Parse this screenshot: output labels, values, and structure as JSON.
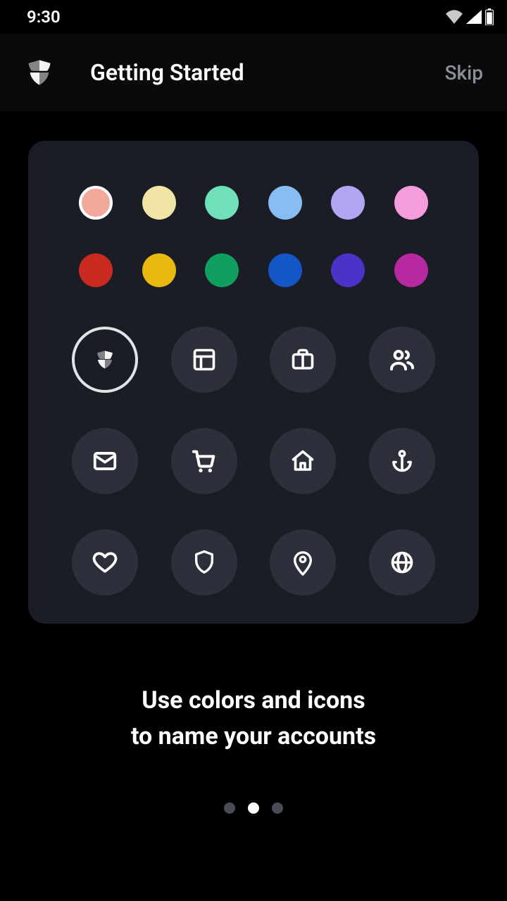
{
  "status": {
    "time": "9:30"
  },
  "header": {
    "title": "Getting Started",
    "skip": "Skip"
  },
  "colors": {
    "row1": [
      "#f2a99c",
      "#f1e5a6",
      "#6fe0b8",
      "#88bdf4",
      "#b2a6f2",
      "#f49cdc"
    ],
    "row2": [
      "#c92a1e",
      "#e9b90f",
      "#0f9e5d",
      "#1556c6",
      "#4b33c8",
      "#b828a0"
    ],
    "selectedIndex": 0
  },
  "icons": {
    "list": [
      "shield",
      "layout",
      "briefcase",
      "users",
      "mail",
      "cart",
      "home",
      "anchor",
      "heart",
      "shield-outline",
      "pin",
      "globe"
    ],
    "selectedIndex": 0
  },
  "caption": "Use colors and icons\nto name your accounts",
  "pager": {
    "count": 3,
    "active": 1
  }
}
